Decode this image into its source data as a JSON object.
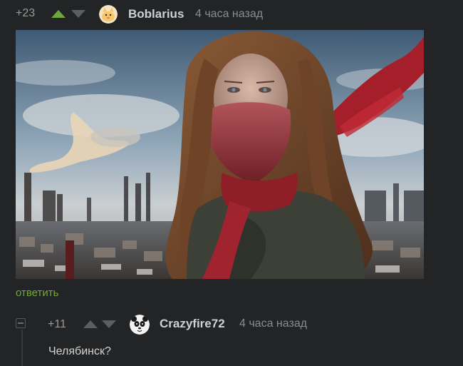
{
  "comment1": {
    "rating": "+23",
    "username": "Boblarius",
    "time": "4 часа назад",
    "reply_label": "ответить",
    "avatar_icon": "avatar-cat-icon",
    "upvoted": true
  },
  "comment2": {
    "rating": "+11",
    "username": "Crazyfire72",
    "time": "4 часа назад",
    "text": "Челябинск?",
    "avatar_icon": "avatar-panda-icon"
  },
  "colors": {
    "background": "#232425",
    "upvote_active": "#6ea83a",
    "vote_neutral": "#5c5e61",
    "reply_link": "#73a83c",
    "username": "#cfd0d1",
    "meta": "#8b8c8d"
  }
}
